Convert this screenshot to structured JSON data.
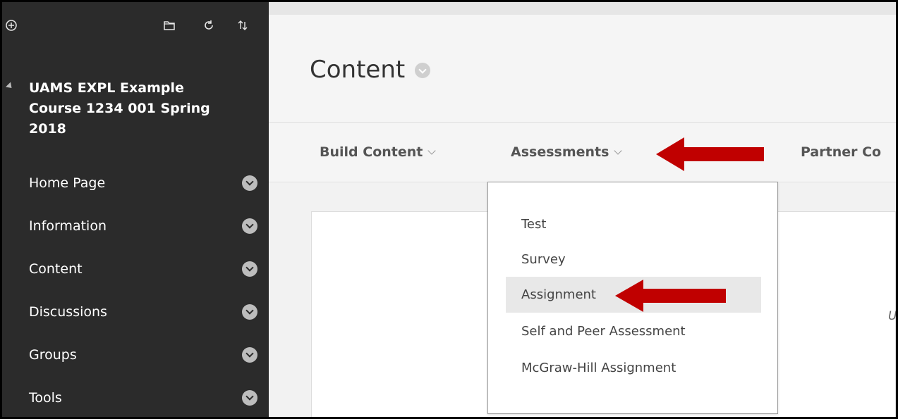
{
  "sidebar": {
    "course_title": "UAMS EXPL Example Course 1234 001 Spring 2018",
    "toolbar_icons": [
      "add-icon",
      "folder-icon",
      "refresh-icon",
      "sort-icon"
    ],
    "items": [
      {
        "label": "Home Page"
      },
      {
        "label": "Information"
      },
      {
        "label": "Content"
      },
      {
        "label": "Discussions"
      },
      {
        "label": "Groups"
      },
      {
        "label": "Tools"
      }
    ]
  },
  "main": {
    "page_title": "Content",
    "actions": [
      {
        "label": "Build Content"
      },
      {
        "label": "Assessments"
      },
      {
        "label": "Partner Co"
      }
    ],
    "dropdown": {
      "items": [
        {
          "label": "Test"
        },
        {
          "label": "Survey"
        },
        {
          "label": "Assignment",
          "highlighted": true
        },
        {
          "label": "Self and Peer Assessment"
        },
        {
          "label": "McGraw-Hill Assignment"
        }
      ]
    },
    "cutoff_glyph": "U"
  },
  "colors": {
    "sidebar_bg": "#2b2b2b",
    "arrow": "#c00000",
    "highlight": "#e8e8e8"
  }
}
